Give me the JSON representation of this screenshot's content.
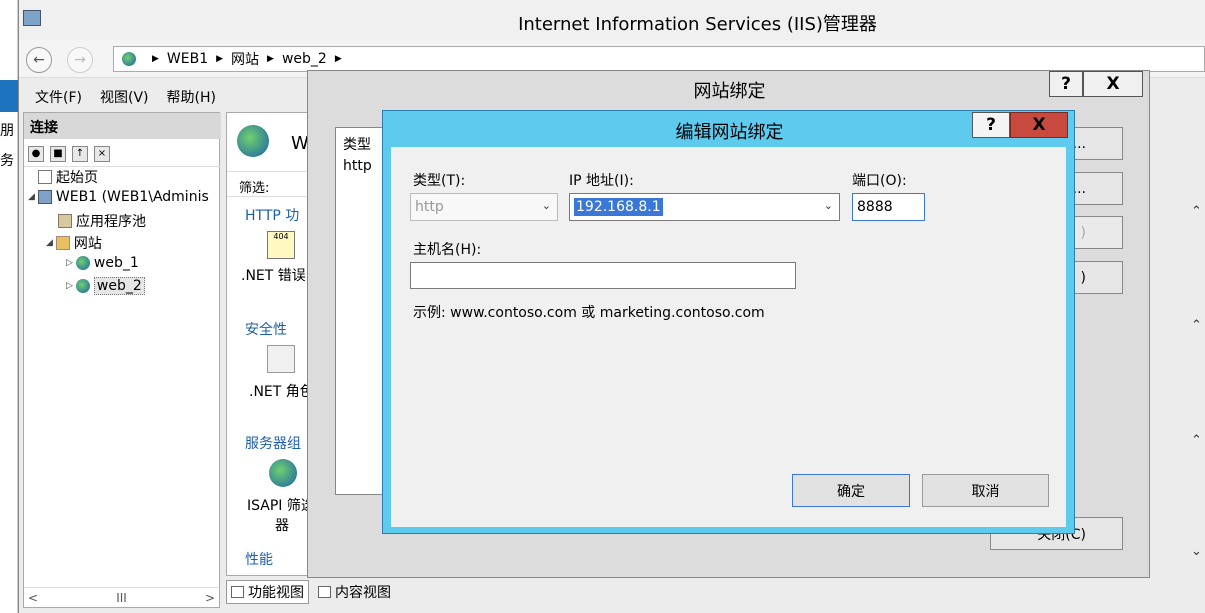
{
  "window": {
    "title": "Internet Information Services (IIS)管理器"
  },
  "desktop": {
    "left_text_1": "朋",
    "left_text_2": "务"
  },
  "address_bar": {
    "breadcrumb": [
      "WEB1",
      "网站",
      "web_2"
    ]
  },
  "menu": {
    "items": [
      "文件(F)",
      "视图(V)",
      "帮助(H)"
    ]
  },
  "connections": {
    "header": "连接",
    "tree": [
      {
        "label": "起始页"
      },
      {
        "label": "WEB1 (WEB1\\Adminis"
      },
      {
        "label": "应用程序池"
      },
      {
        "label": "网站"
      },
      {
        "label": "web_1"
      },
      {
        "label": "web_2"
      }
    ],
    "hscroll_mid": "III"
  },
  "center": {
    "site_name": "W",
    "filter_label": "筛选:",
    "categories": {
      "http": "HTTP 功",
      "security": "安全性",
      "server": "服务器组",
      "perf": "性能"
    },
    "features": {
      "net_error": ".NET 错误",
      "net_role": ".NET 角色",
      "isapi_1": "ISAPI 筛选",
      "isapi_2": "器",
      "error_code": "404"
    },
    "bottom_tabs": [
      "功能视图",
      "内容视图"
    ]
  },
  "bindings_dialog": {
    "title": "网站绑定",
    "help": "?",
    "close": "X",
    "list_header": "类型",
    "list_row": "http",
    "side_buttons": [
      "...",
      "...",
      ")",
      ")",
      "关闭(C)"
    ]
  },
  "edit_dialog": {
    "title": "编辑网站绑定",
    "help": "?",
    "close": "X",
    "type_label": "类型(T):",
    "type_value": "http",
    "ip_label": "IP 地址(I):",
    "ip_value": "192.168.8.1",
    "port_label": "端口(O):",
    "port_value": "8888",
    "host_label": "主机名(H):",
    "host_value": "",
    "example": "示例: www.contoso.com 或 marketing.contoso.com",
    "ok": "确定",
    "cancel": "取消"
  }
}
